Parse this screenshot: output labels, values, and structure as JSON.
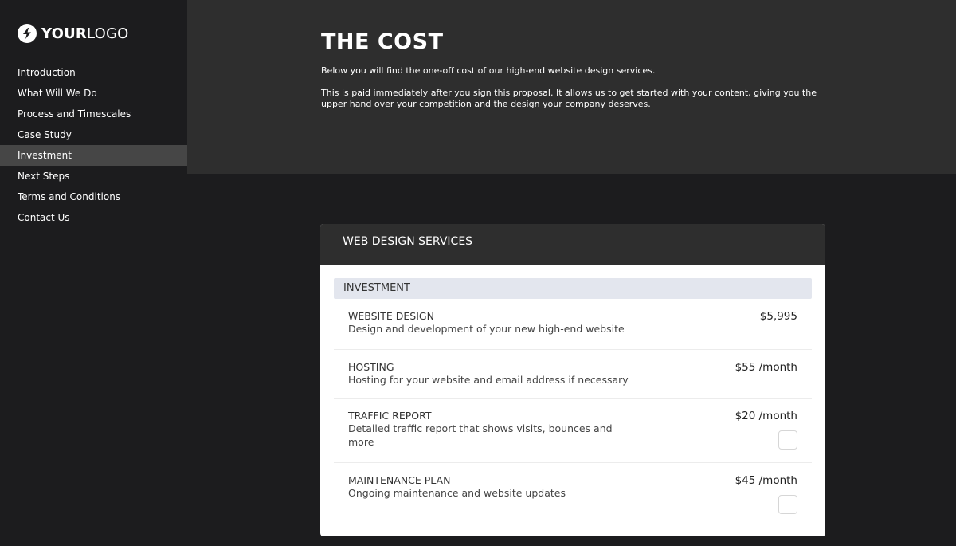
{
  "logo": {
    "bold": "YOUR",
    "light": "LOGO",
    "icon": "lightning-bolt-icon"
  },
  "sidebar": {
    "items": [
      {
        "label": "Introduction",
        "active": false
      },
      {
        "label": "What Will We Do",
        "active": false
      },
      {
        "label": "Process and Timescales",
        "active": false
      },
      {
        "label": "Case Study",
        "active": false
      },
      {
        "label": "Investment",
        "active": true
      },
      {
        "label": "Next Steps",
        "active": false
      },
      {
        "label": "Terms and Conditions",
        "active": false
      },
      {
        "label": "Contact Us",
        "active": false
      }
    ]
  },
  "hero": {
    "title": "THE COST",
    "paragraphs": [
      "Below you will find the one-off cost of our high-end website design services.",
      "This is paid immediately after you sign this proposal. It allows us to get started with your content, giving you the upper hand over your competition and the design your company deserves."
    ]
  },
  "card": {
    "title": "WEB DESIGN SERVICES",
    "section": "INVESTMENT",
    "items": [
      {
        "title": "WEBSITE DESIGN",
        "desc": "Design and development of your new high-end website",
        "price": "$5,995",
        "optional": false
      },
      {
        "title": "HOSTING",
        "desc": "Hosting for your website and email address if necessary",
        "price": "$55 /month",
        "optional": false
      },
      {
        "title": "TRAFFIC REPORT",
        "desc": "Detailed traffic report that shows visits, bounces and more",
        "price": "$20 /month",
        "optional": true,
        "checked": false
      },
      {
        "title": "MAINTENANCE PLAN",
        "desc": "Ongoing maintenance and website updates",
        "price": "$45 /month",
        "optional": true,
        "checked": false
      }
    ]
  },
  "colors": {
    "sidebar_bg": "#1c1c1e",
    "active_item_bg": "#464646",
    "hero_bg": "#2e2e2e",
    "section_bar_bg": "#e3e6ee"
  }
}
